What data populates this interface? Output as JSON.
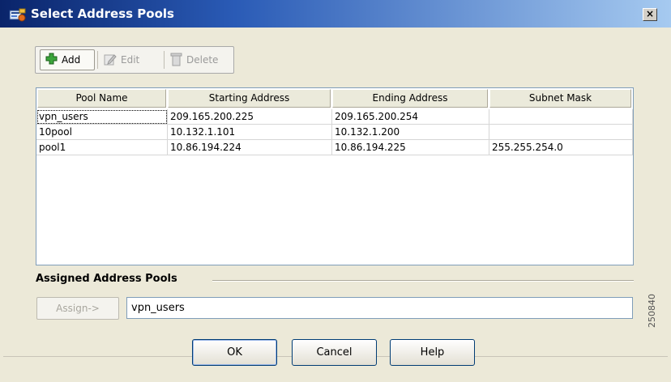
{
  "window": {
    "title": "Select Address Pools",
    "close_label": "×",
    "icon": "address-pool-app-icon"
  },
  "toolbar": {
    "add_label": "Add",
    "edit_label": "Edit",
    "delete_label": "Delete",
    "add_icon": "plus-icon",
    "edit_icon": "edit-icon",
    "delete_icon": "trash-icon"
  },
  "table": {
    "columns": [
      "Pool Name",
      "Starting Address",
      "Ending Address",
      "Subnet Mask"
    ],
    "rows": [
      [
        "vpn_users",
        "209.165.200.225",
        "209.165.200.254",
        ""
      ],
      [
        "10pool",
        "10.132.1.101",
        "10.132.1.200",
        ""
      ],
      [
        "pool1",
        "10.86.194.224",
        "10.86.194.225",
        "255.255.254.0"
      ]
    ]
  },
  "assigned": {
    "section_label": "Assigned Address Pools",
    "assign_label": "Assign->",
    "value": "vpn_users"
  },
  "buttons": {
    "ok": "OK",
    "cancel": "Cancel",
    "help": "Help"
  },
  "watermark": "250840",
  "colors": {
    "title_start": "#0a246a",
    "title_end": "#a6caf0",
    "panel": "#ece9d8",
    "add_icon_green": "#2e8b2e"
  }
}
